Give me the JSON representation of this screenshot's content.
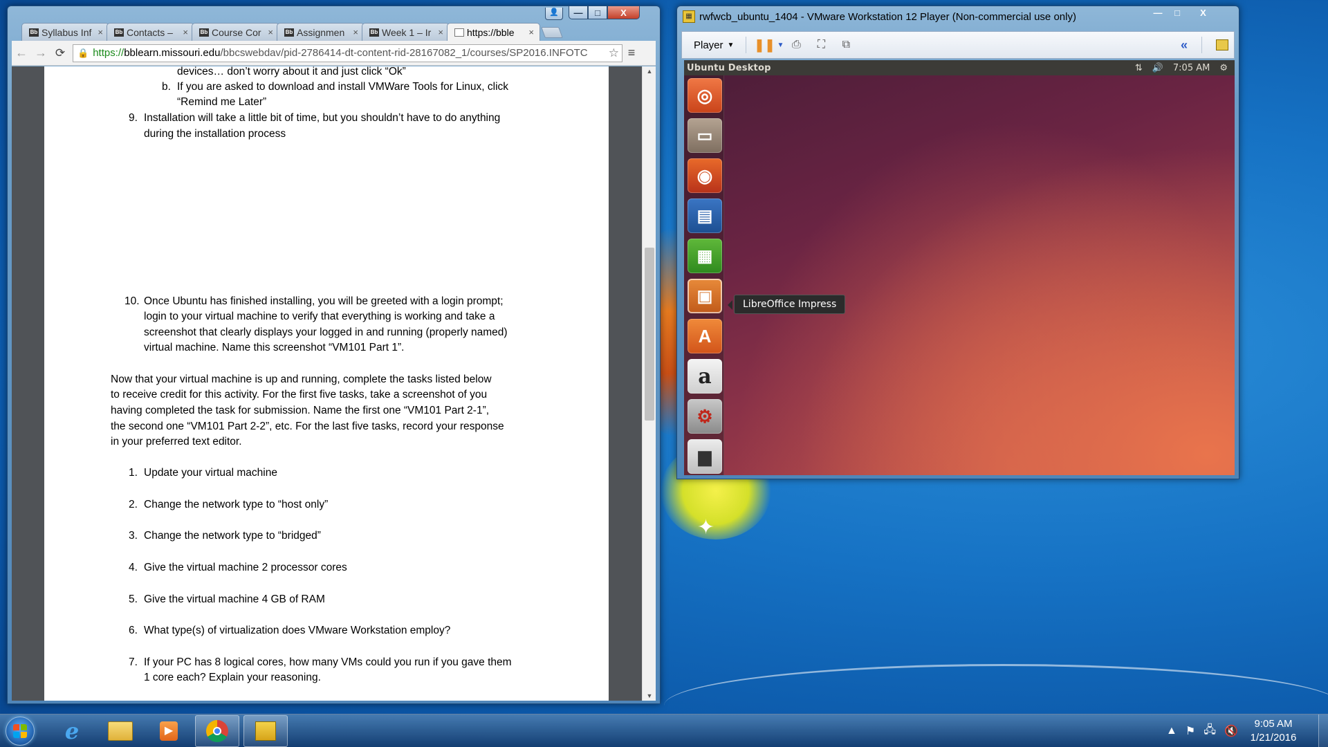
{
  "chrome": {
    "tabs": [
      {
        "label": "Syllabus Inf",
        "favicon": "Bb",
        "close": "×"
      },
      {
        "label": "Contacts –",
        "favicon": "Bb",
        "close": "×"
      },
      {
        "label": "Course Cor",
        "favicon": "Bb",
        "close": "×"
      },
      {
        "label": "Assignmen",
        "favicon": "Bb",
        "close": "×"
      },
      {
        "label": "Week 1 – Ir",
        "favicon": "Bb",
        "close": "×"
      },
      {
        "label": "https://bble",
        "favicon": "",
        "close": "×"
      }
    ],
    "url_scheme": "https://",
    "url_host": "bblearn.missouri.edu",
    "url_path": "/bbcswebdav/pid-2786414-dt-content-rid-28167082_1/courses/SP2016.INFOTC",
    "caption": {
      "min": "—",
      "max": "□",
      "close": "X"
    }
  },
  "document": {
    "page1": [
      "devices… don’t worry about it and just click “Ok”",
      "b.",
      "If you are asked to download and install VMWare Tools for Linux, click",
      "“Remind me Later”",
      "9.",
      "Installation will take a little bit of time, but you shouldn’t have to do anything",
      "during the installation process"
    ],
    "step10_num": "10.",
    "step10": [
      "Once Ubuntu has finished installing, you will be greeted with a login prompt;",
      "login to your virtual machine to verify that everything is working and take a",
      "screenshot that clearly displays your logged in and running (properly named)",
      "virtual machine.  Name this screenshot “VM101 Part 1”."
    ],
    "intro": [
      "Now that your virtual machine is up and running, complete the tasks listed below",
      "to receive credit for this activity.  For the first five tasks, take a screenshot of you",
      "having completed the task for submission.  Name the first one “VM101 Part 2-1”,",
      "the second one “VM101 Part 2-2”, etc.  For the last five tasks, record your response",
      "in your preferred text editor."
    ],
    "tasks": [
      {
        "num": "1.",
        "text": "Update your virtual machine"
      },
      {
        "num": "2.",
        "text": "Change the network type to “host only”"
      },
      {
        "num": "3.",
        "text": "Change the network type to “bridged”"
      },
      {
        "num": "4.",
        "text": "Give the virtual machine 2 processor cores"
      },
      {
        "num": "5.",
        "text": "Give the virtual machine 4 GB of RAM"
      },
      {
        "num": "6.",
        "text": "What type(s) of virtualization does VMware Workstation employ?"
      },
      {
        "num": "7.",
        "text": "If your PC has 8 logical cores, how many VMs could you run if you gave them"
      }
    ],
    "task7_cont": "1 core each?  Explain your reasoning."
  },
  "vmware": {
    "title": "rwfwcb_ubuntu_1404 - VMware Workstation 12 Player (Non-commercial use only)",
    "player_label": "Player",
    "ubuntu": {
      "panel_title": "Ubuntu Desktop",
      "time": "7:05 AM",
      "tooltip": "LibreOffice Impress"
    }
  },
  "taskbar": {
    "time": "9:05 AM",
    "date": "1/21/2016"
  },
  "colors": {
    "chrome_frame": "#5a8ec0",
    "ubuntu_panel": "#3c3b37",
    "taskbar": "#1d4f86"
  }
}
